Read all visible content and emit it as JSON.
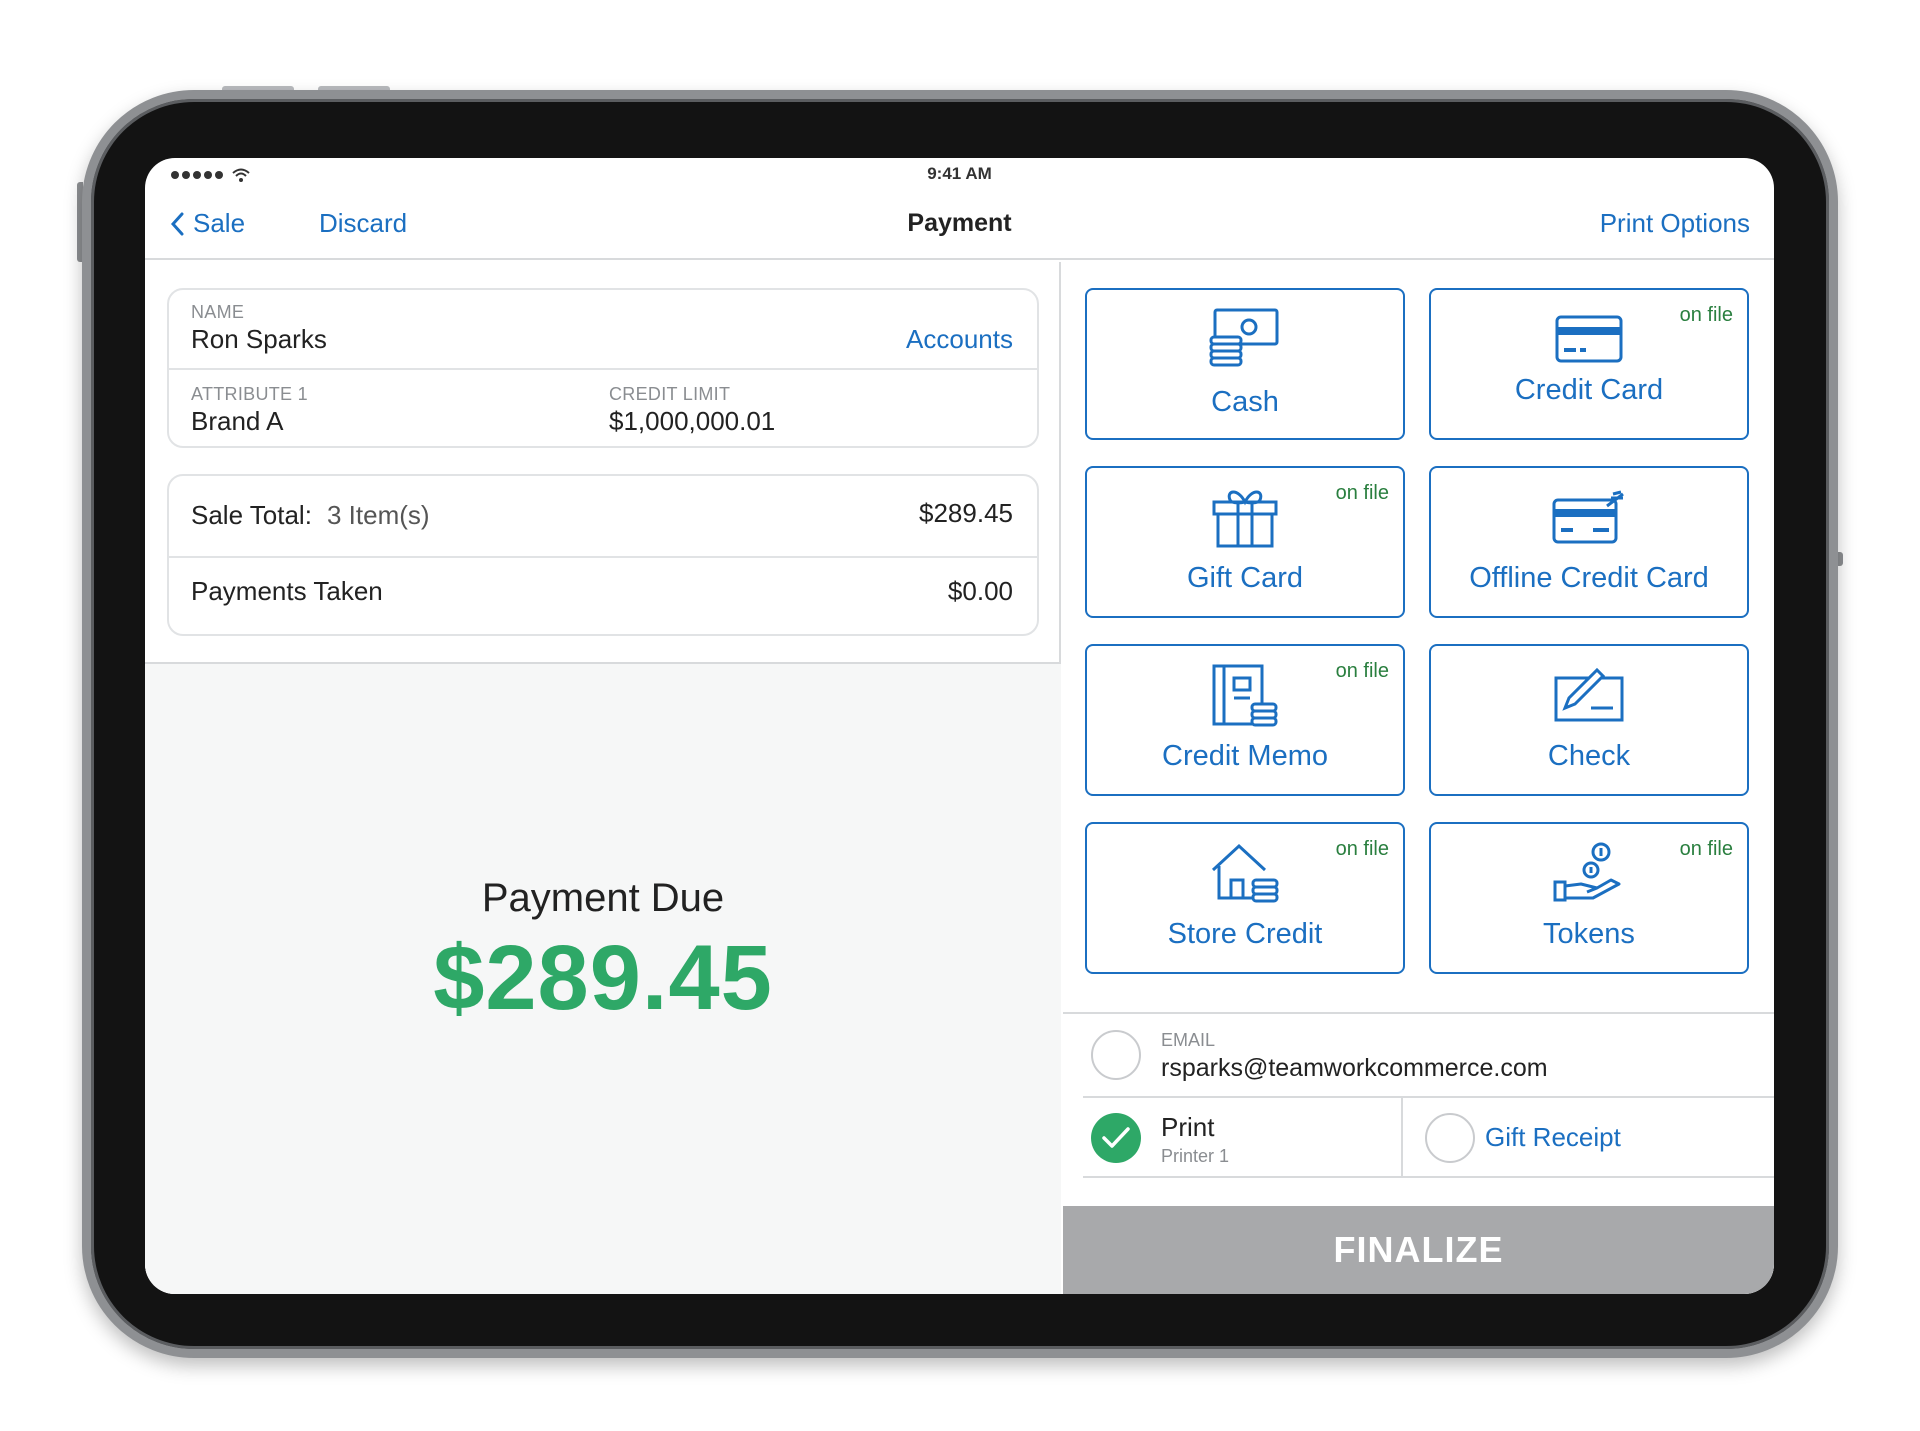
{
  "status": {
    "time": "9:41 AM"
  },
  "nav": {
    "back_label": "Sale",
    "discard_label": "Discard",
    "title": "Payment",
    "print_options_label": "Print Options"
  },
  "customer": {
    "name_label": "NAME",
    "name": "Ron Sparks",
    "accounts_link": "Accounts",
    "attribute_label": "ATTRIBUTE 1",
    "attribute_value": "Brand A",
    "credit_limit_label": "CREDIT LIMIT",
    "credit_limit_value": "$1,000,000.01"
  },
  "totals": {
    "sale_total_label": "Sale Total:",
    "items": "3 Item(s)",
    "sale_total_value": "$289.45",
    "payments_label": "Payments Taken",
    "payments_value": "$0.00"
  },
  "due": {
    "label": "Payment Due",
    "amount": "$289.45"
  },
  "tenders": [
    {
      "label": "Cash",
      "icon": "cash-icon",
      "badge": ""
    },
    {
      "label": "Credit Card",
      "icon": "credit-card-icon",
      "badge": "on file"
    },
    {
      "label": "Gift Card",
      "icon": "gift-icon",
      "badge": "on file"
    },
    {
      "label": "Offline Credit Card",
      "icon": "offline-card-icon",
      "badge": ""
    },
    {
      "label": "Credit Memo",
      "icon": "credit-memo-icon",
      "badge": "on file"
    },
    {
      "label": "Check",
      "icon": "check-pen-icon",
      "badge": ""
    },
    {
      "label": "Store Credit",
      "icon": "store-credit-icon",
      "badge": "on file"
    },
    {
      "label": "Tokens",
      "icon": "tokens-icon",
      "badge": "on file"
    }
  ],
  "receipt": {
    "email_label": "EMAIL",
    "email_value": "rsparks@teamworkcommerce.com",
    "print_label": "Print",
    "print_sub": "Printer 1",
    "gift_receipt_label": "Gift Receipt"
  },
  "finalize_label": "FINALIZE",
  "colors": {
    "accent": "#1b6fc1",
    "success": "#2ea867",
    "badge": "#2a7f3f",
    "disabled": "#a8a9ab"
  }
}
